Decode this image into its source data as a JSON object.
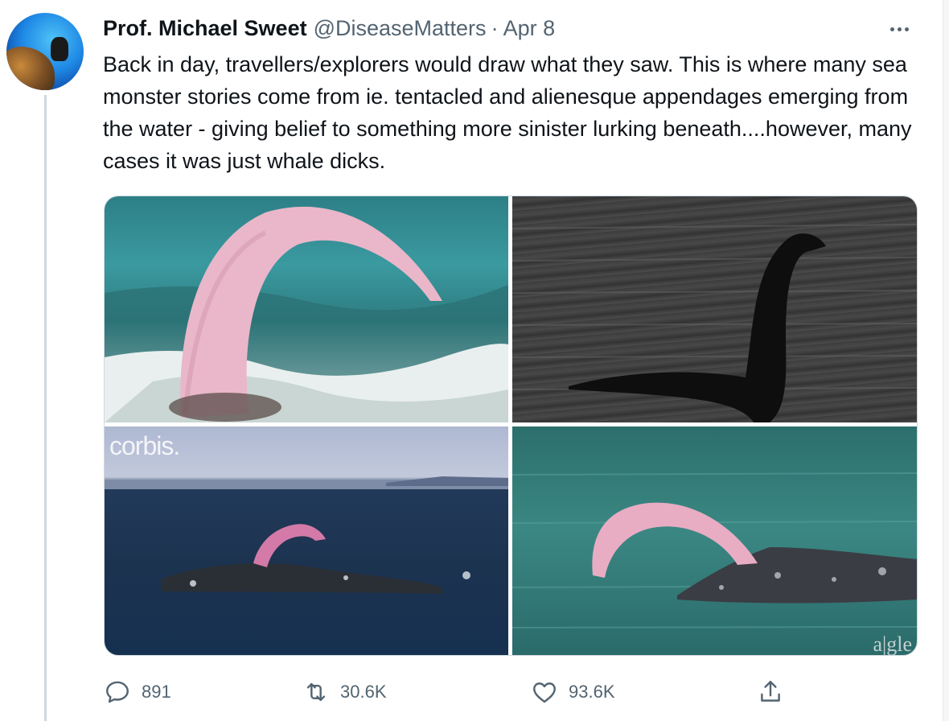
{
  "tweet": {
    "author_name": "Prof. Michael Sweet",
    "handle": "@DiseaseMatters",
    "separator": "·",
    "date": "Apr 8",
    "text": "Back in day, travellers/explorers would draw what they saw. This is where many sea monster stories come from ie. tentacled and alienesque appendages emerging from the water - giving belief to something more sinister lurking beneath....however, many cases it was just whale dicks.",
    "media": {
      "watermark_top_left": "corbis.",
      "watermark_bottom_right": "a|gle"
    },
    "actions": {
      "reply_count": "891",
      "retweet_count": "30.6K",
      "like_count": "93.6K"
    }
  },
  "icons": {
    "more": "more-horizontal-icon",
    "reply": "reply-icon",
    "retweet": "retweet-icon",
    "like": "heart-icon",
    "share": "share-icon"
  },
  "colors": {
    "text_primary": "#0f1419",
    "text_secondary": "#536471",
    "border": "#cfd9de"
  }
}
